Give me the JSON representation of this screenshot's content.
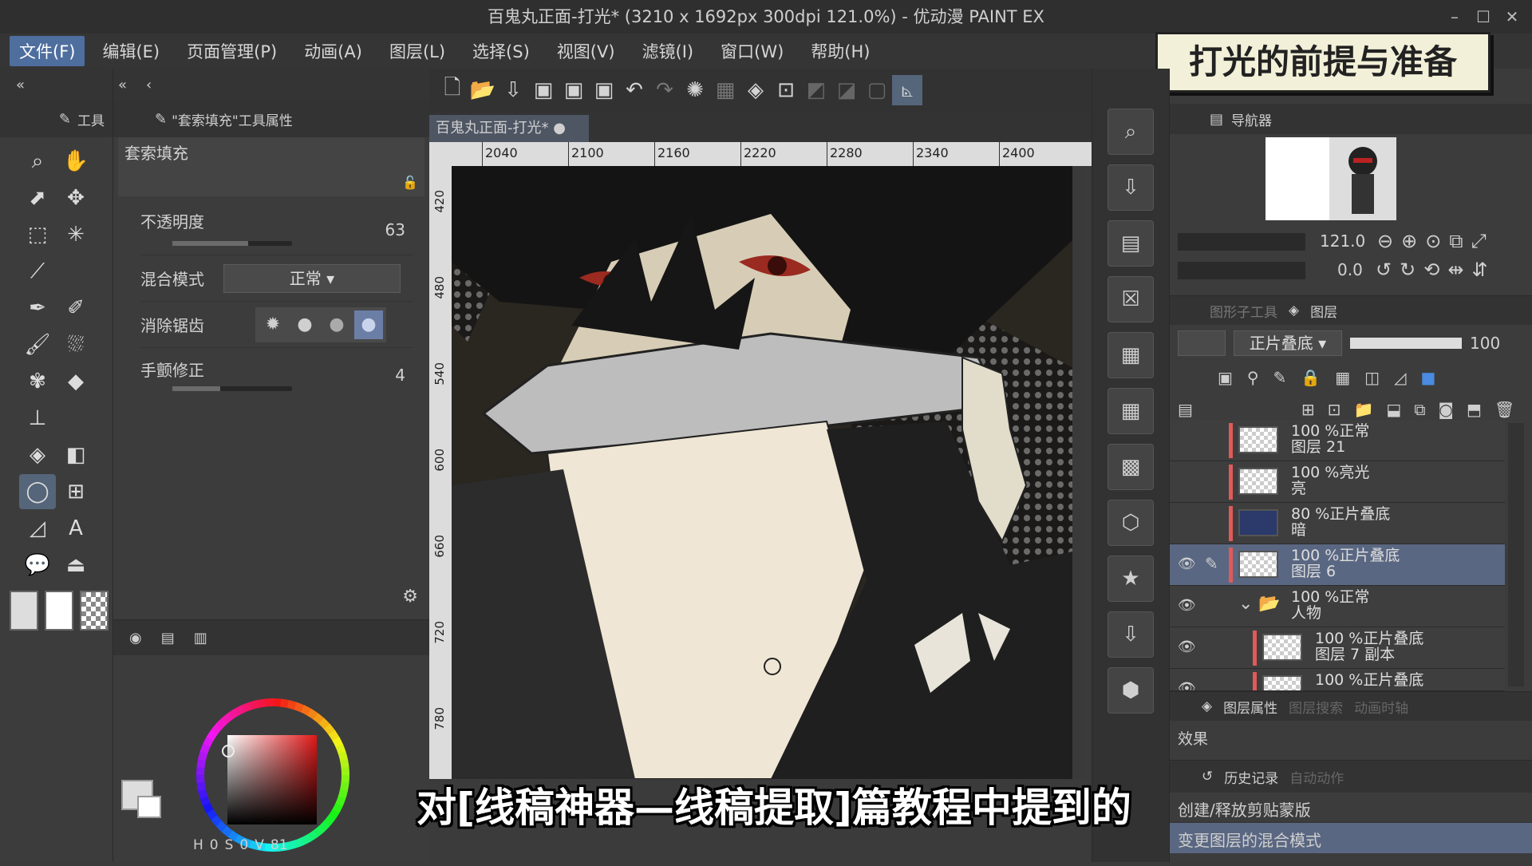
{
  "window": {
    "title": "百鬼丸正面-打光* (3210 x 1692px 300dpi 121.0%) - 优动漫 PAINT EX"
  },
  "menu": [
    "文件(F)",
    "编辑(E)",
    "页面管理(P)",
    "动画(A)",
    "图层(L)",
    "选择(S)",
    "视图(V)",
    "滤镜(I)",
    "窗口(W)",
    "帮助(H)"
  ],
  "banner": "打光的前提与准备",
  "tool_tabs": {
    "tools": "工具",
    "props": "\"套索填充\"工具属性"
  },
  "tool_props": {
    "name": "套索填充",
    "opacity_label": "不透明度",
    "opacity_value": "63",
    "opacity_pct": 63,
    "blend_label": "混合模式",
    "blend_value": "正常",
    "aa_label": "消除锯齿",
    "stabilizer_label": "手颤修正",
    "stabilizer_value": "4",
    "stabilizer_pct": 40
  },
  "canvas_tab": "百鬼丸正面-打光*",
  "ruler": {
    "h": [
      "2040",
      "2100",
      "2160",
      "2220",
      "2280",
      "2340",
      "2400"
    ],
    "v": [
      "420",
      "480",
      "540",
      "600",
      "660",
      "720",
      "780"
    ]
  },
  "color": {
    "h": "0",
    "s": "0",
    "v": "81",
    "h_label": "H",
    "s_label": "S",
    "v_label": "V"
  },
  "navigator": {
    "tab": "导航器",
    "zoom": "121.0",
    "rotate": "0.0"
  },
  "layer_panel": {
    "tab_sub": "图形子工具",
    "tab": "图层",
    "blend": "正片叠底",
    "opacity": "100",
    "layers": [
      {
        "mode": "100 %正常",
        "name": "图层 21"
      },
      {
        "mode": "100 %亮光",
        "name": "亮"
      },
      {
        "mode": "80 %正片叠底",
        "name": "暗"
      },
      {
        "mode": "100 %正片叠底",
        "name": "图层 6"
      },
      {
        "mode": "100 %正常",
        "name": "人物"
      },
      {
        "mode": "100 %正片叠底",
        "name": "图层 7 副本"
      },
      {
        "mode": "100 %正片叠底",
        "name": ""
      }
    ]
  },
  "layer_props": {
    "tab": "图层属性",
    "tab2": "图层搜索",
    "tab3": "动画时轴",
    "effect": "效果"
  },
  "history": {
    "tab": "历史记录",
    "tab2": "自动动作",
    "items": [
      "创建/释放剪贴蒙版",
      "变更图层的混合模式"
    ]
  },
  "subtitle": "对[线稿神器—线稿提取]篇教程中提到的",
  "colors": {
    "accent": "#4e6e9e",
    "selected_layer": "#5a6782",
    "layer_marker": "#e05a5a"
  }
}
